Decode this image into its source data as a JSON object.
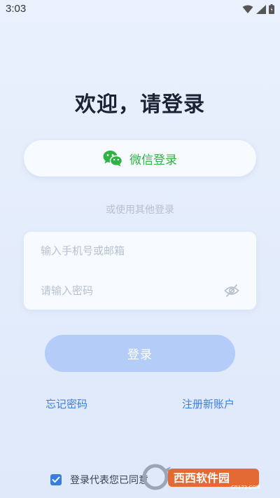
{
  "status_bar": {
    "time": "3:03",
    "icons": [
      "wifi-icon",
      "signal-icon",
      "battery-icon"
    ]
  },
  "title": "欢迎，请登录",
  "wechat_login": {
    "label": "微信登录",
    "icon": "wechat-icon"
  },
  "other_login_label": "或使用其他登录",
  "form": {
    "account_placeholder": "输入手机号或邮箱",
    "account_value": "",
    "password_placeholder": "请输入密码",
    "password_value": "",
    "visibility_icon": "eye-off-icon"
  },
  "login_button": "登录",
  "links": {
    "forgot_password": "忘记密码",
    "register": "注册新账户"
  },
  "agreement": {
    "checked": true,
    "text": "登录代表您已同意"
  },
  "watermark": {
    "brand_text": "西西软件园",
    "site_text": "CR173.COM"
  },
  "colors": {
    "accent": "#3a7de0",
    "wechat_green": "#2fb244",
    "login_button_disabled": "#b3cdf8",
    "background": "#e6eefc"
  }
}
